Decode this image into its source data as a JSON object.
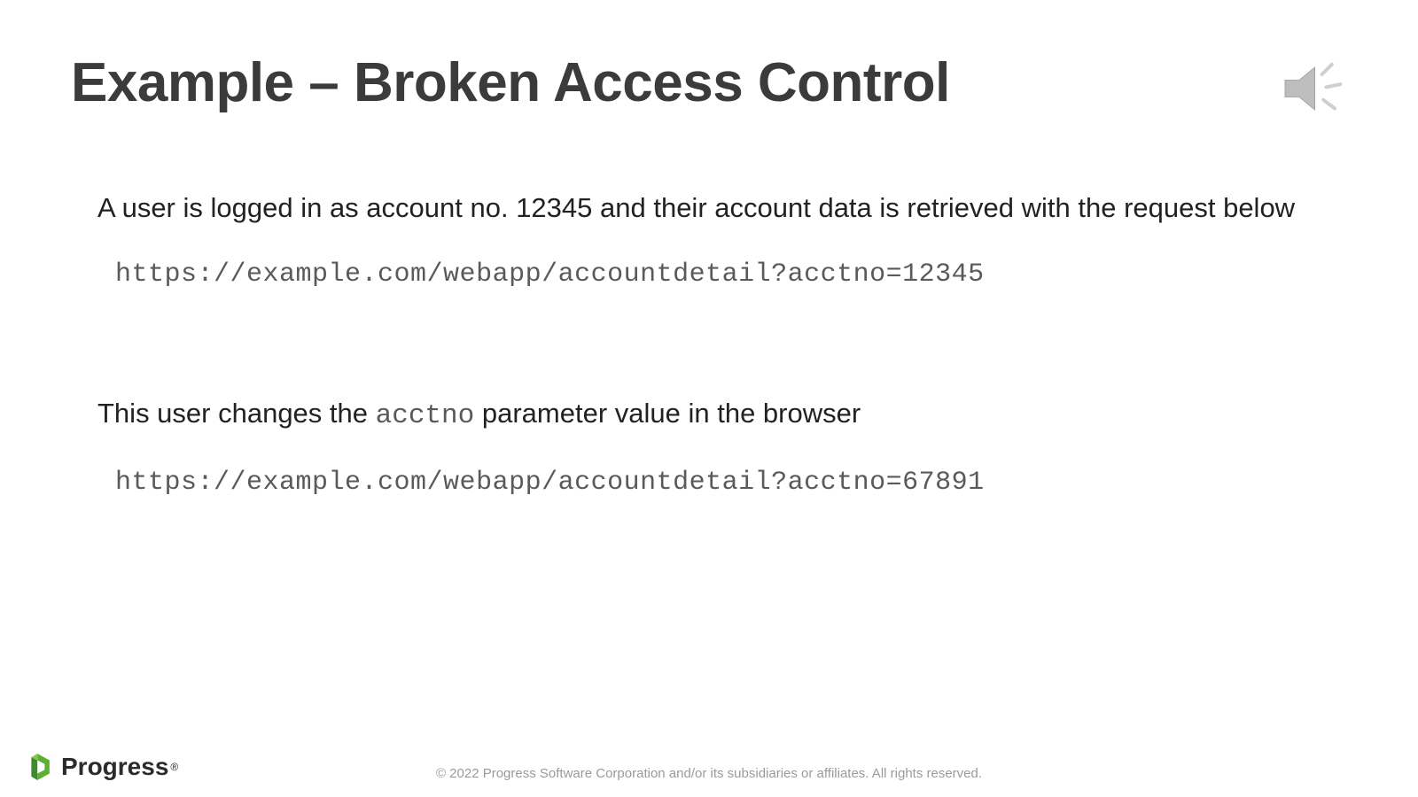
{
  "slide": {
    "title": "Example – Broken Access Control",
    "paragraph1": "A user is logged in as account no. 12345 and their account data is retrieved with the request below",
    "url1": "https://example.com/webapp/accountdetail?acctno=12345",
    "paragraph2_pre": "This user changes the ",
    "paragraph2_code": "acctno",
    "paragraph2_post": " parameter value in the browser",
    "url2": "https://example.com/webapp/accountdetail?acctno=67891"
  },
  "footer": {
    "copyright": "© 2022 Progress Software Corporation and/or its subsidiaries or affiliates. All rights reserved."
  },
  "logo": {
    "text": "Progress"
  },
  "icons": {
    "sound": "sound-icon",
    "logo_mark": "progress-mark-icon"
  }
}
